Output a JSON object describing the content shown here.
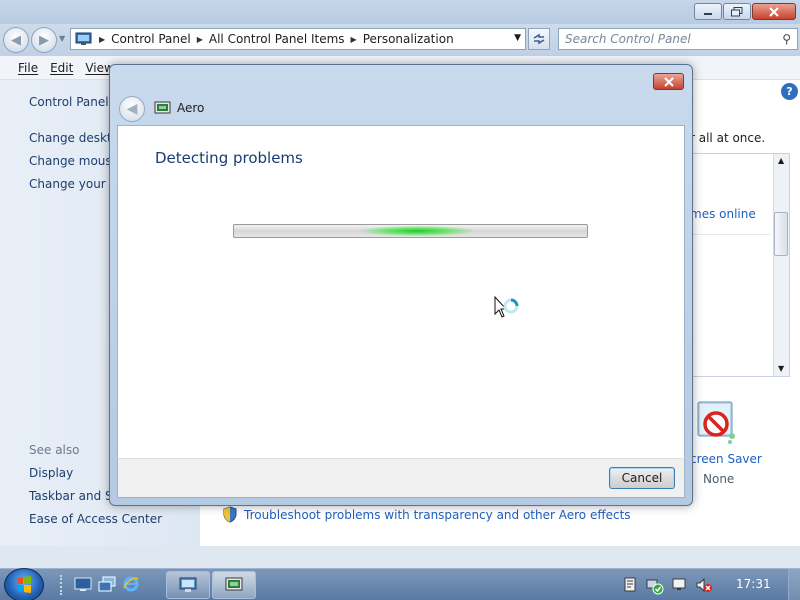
{
  "window": {
    "addressbar": {
      "crumbs": [
        "Control Panel",
        "All Control Panel Items",
        "Personalization"
      ]
    },
    "search_placeholder": "Search Control Panel",
    "menu": [
      "File",
      "Edit",
      "View"
    ]
  },
  "left_pane": {
    "home_link": "Control Panel H",
    "links": [
      "Change deskto",
      "Change mouse",
      "Change your a"
    ],
    "see_also_title": "See also",
    "see_also": [
      "Display",
      "Taskbar and St",
      "Ease of Access Center"
    ]
  },
  "main_pane": {
    "partial_header": "r all at once.",
    "themes_online": "mes online",
    "screen_saver_label": "creen Saver",
    "screen_saver_value": "None",
    "troubleshoot_link": "Troubleshoot problems with transparency and other Aero effects"
  },
  "dialog": {
    "title": "Aero",
    "heading": "Detecting problems",
    "progress_indeterminate": true,
    "cancel_label": "Cancel"
  },
  "taskbar": {
    "clock": "17:31"
  },
  "icons": {
    "window": [
      "back-arrow-icon",
      "forward-arrow-icon",
      "control-panel-icon",
      "refresh-icon",
      "search-icon",
      "help-icon",
      "screen-saver-icon",
      "shield-icon"
    ],
    "taskbar": [
      "windows-start-icon",
      "show-desktop-icon",
      "window-switcher-icon",
      "internet-explorer-icon",
      "action-center-flag-icon",
      "network-icon",
      "speaker-muted-icon"
    ]
  },
  "colors": {
    "accent_link": "#1f5fbf",
    "heading": "#1a3c74",
    "progress_glow": "#1fcc2a"
  }
}
